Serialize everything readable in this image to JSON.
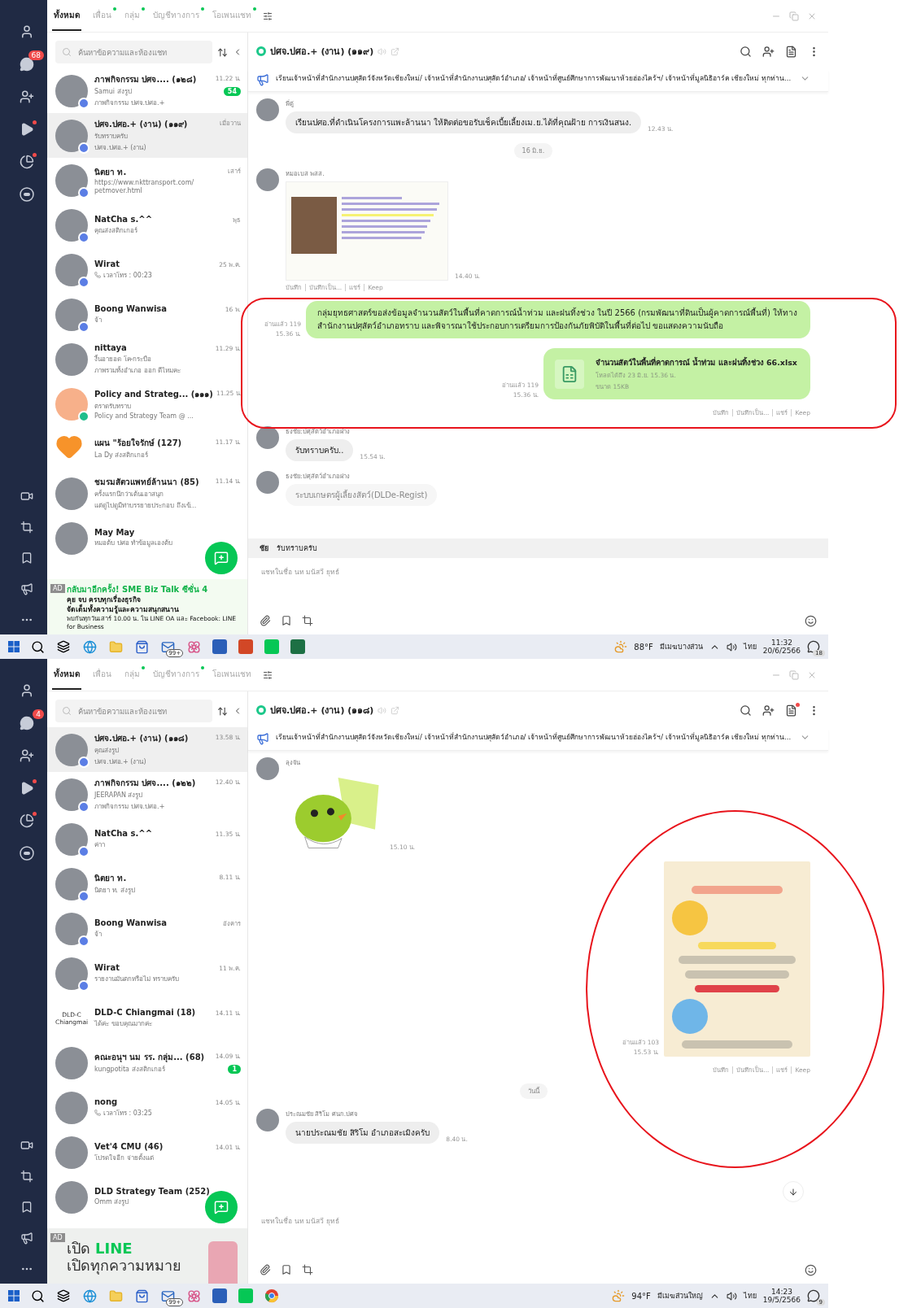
{
  "screens": [
    {
      "nav": {
        "chat_badge": "68"
      },
      "tabs": [
        {
          "label": "ทั้งหมด",
          "selected": true,
          "dot": false
        },
        {
          "label": "เพื่อน",
          "selected": false,
          "dot": true
        },
        {
          "label": "กลุ่ม",
          "selected": false,
          "dot": true
        },
        {
          "label": "บัญชีทางการ",
          "selected": false,
          "dot": true
        },
        {
          "label": "โอเพนแชท",
          "selected": false,
          "dot": true
        }
      ],
      "search": {
        "placeholder": "ค้นหาข้อความและห้องแชท"
      },
      "chats": [
        {
          "name": "ภาพกิจกรรม ปศจ.... (๑๒๘)",
          "time": "11.22 น.",
          "kind": "message",
          "avatar": {
            "kind": "photo"
          },
          "line1": "Samui ส่งรูป",
          "line2": "ภาพกิจกรรม ปศจ.ปศอ.+",
          "unread": "54",
          "selected": false
        },
        {
          "name": "ปศจ.ปศอ.+ (งาน) (๑๑๙)",
          "time": "เมื่อวาน",
          "kind": "message",
          "avatar": {
            "kind": "photo"
          },
          "line1": "รับทราบครับ",
          "line2": "ปศจ.ปศอ.+ (งาน)",
          "selected": true
        },
        {
          "name": "นิตยา ท.",
          "time": "เสาร์",
          "kind": "message",
          "avatar": {
            "kind": "photo"
          },
          "line1": "https://www.nkttransport.com/",
          "line2": "petmover.html",
          "selected": false
        },
        {
          "name": "NatCha s.^^",
          "time": "พุธ",
          "kind": "message",
          "avatar": {
            "kind": "photo"
          },
          "line1": "คุณส่งสติกเกอร์",
          "selected": false
        },
        {
          "name": "Wirat",
          "time": "25 พ.ค.",
          "kind": "call",
          "avatar": {
            "kind": "photo"
          },
          "line1": "เวลาโทร : 00:23",
          "selected": false
        },
        {
          "name": "Boong Wanwisa",
          "time": "16 พ.",
          "kind": "message",
          "avatar": {
            "kind": "photo"
          },
          "line1": "จ้า",
          "selected": false
        },
        {
          "name": "nittaya",
          "time": "11.29 น.",
          "kind": "message",
          "avatar": {
            "kind": "plain"
          },
          "line1": "งื้นอายอด โค-กระบือ",
          "line2": "ภาพรวมทั้งอำเภอ ออก ดีไหมคะ",
          "selected": false
        },
        {
          "name": "Policy and Strateg... (๑๑๑)",
          "time": "11.25 น.",
          "kind": "message",
          "avatar": {
            "kind": "group"
          },
          "line1": "ตราดรับทราบ",
          "line2": "Policy and Strategy Team @ ...",
          "selected": false
        },
        {
          "name": "แผน \"ร้อยใจรักษ์ (127)",
          "time": "11.17 น.",
          "kind": "message",
          "avatar": {
            "kind": "heart"
          },
          "line1": "La Dy ส่งสติกเกอร์",
          "selected": false
        },
        {
          "name": "ชมรมสัตวแพทย์ล้านนา (85)",
          "time": "11.14 น.",
          "kind": "message",
          "avatar": {
            "kind": "plain"
          },
          "line1": "ครั้งแรกนึกว่าเต้นเอาสนุก",
          "line2": "แต่ดูไปดูมีท่าบรรยายประกอบ ถึงเข้...",
          "selected": false
        },
        {
          "name": "May May",
          "kind": "message",
          "avatar": {
            "kind": "plain"
          },
          "line1": "หมอต้บ ปศอ ทำข้อมูลเองต้บ",
          "selected": false
        }
      ],
      "ad": {
        "kind": "biz",
        "tag": "AD",
        "lines": [
          "กลับมาอีกครั้ง! SME Biz Talk ซีซั่น 4",
          "คุย จบ ครบทุกเรื่องธุรกิจ",
          "จัดเต็มทั้งความรู้และความสนุกสนาน",
          "พบกันทุกวันเสาร์ 10.00 น. ใน LINE OA และ Facebook: LINE for Business"
        ]
      },
      "chat": {
        "title": "ปศจ.ปศอ.+ (งาน) (๑๑๙)",
        "notes_dot": false,
        "announcement": "เรียนเจ้าหน้าที่สำนักงานปศุสัตว์จังหวัดเชียงใหม่/ เจ้าหน้าที่สำนักงานปศุสัตว์อำเภอ/ เจ้าหน้าที่ศูนย์ศึกษาการพัฒนาห้วยฮ่องไคร้ฯ/ เจ้าหน้าที่มูลนิธิอาร์ค เชียงใหม่ ทุกท่าน...",
        "messages": [
          {
            "kind": "text_in",
            "sender": "พี่ตู่",
            "text": "เรียนปศอ.ที่ดำเนินโครงการแพะล้านนา ให้ติดต่อขอรับเช็คเบี้ยเลี้ยงเม.ย.ได้ที่คุณฝ้าย การเงินสนง.",
            "time": "12.43 น."
          },
          {
            "kind": "date",
            "text": "16 มิ.ย."
          },
          {
            "kind": "image_in",
            "sender": "หมอเบส พสส.",
            "time": "14.40 น.",
            "actions": [
              "บันทึก",
              "บันทึกเป็น...",
              "แชร์",
              "Keep"
            ]
          },
          {
            "kind": "text_out",
            "read": "อ่านแล้ว 119",
            "time": "15.36 น.",
            "text": "กลุ่มยุทธศาสตร์ขอส่งข้อมูลจำนวนสัตว์ในพื้นที่คาดการณ์น้ำท่วม และฝนทิ้งช่วง ในปี 2566 (กรมพัฒนาที่ดินเป็นผู้คาดการณ์พื้นที่) ให้ทางสำนักงานปศุสัตว์อำเภอทราบ และพิจารณาใช้ประกอบการเตรียมการป้องกันภัยพิบัติในพื้นที่ต่อไป  ขอแสดงความนับถือ"
          },
          {
            "kind": "file_out",
            "read": "อ่านแล้ว 119",
            "time": "15.36 น.",
            "filename": "จำนวนสัตว์ในพื้นที่คาดการณ์ น้ำท่วม และฝนทิ้งช่วง 66.xlsx",
            "expiry": "โหลดได้ถึง 23 มิ.ย. 15.36 น.",
            "size": "ขนาด 15KB",
            "actions": [
              "บันทึก",
              "บันทึกเป็น...",
              "แชร์",
              "Keep"
            ]
          },
          {
            "kind": "text_in",
            "sender": "ธงชัย:ปศุสัตว์อำเภอฝาง",
            "text": "รับทราบครับ..",
            "time": "15.54 น."
          },
          {
            "kind": "faded_in",
            "sender": "ธงชัย:ปศุสัตว์อำเภอฝาง",
            "text": "ระบบเกษตรผู้เลี้ยงสัตว์(DLDe-Regist)"
          }
        ],
        "reply": {
          "name": "ชัย",
          "text": "รับทราบครับ"
        },
        "input": {
          "placeholder": "แชทในชื่อ นท มนัสวี ยุทธ์"
        },
        "scroll_down": false
      },
      "annotation": {
        "kind": "rect"
      },
      "taskbar": {
        "apps": [
          {
            "kind": "search"
          },
          {
            "kind": "taskview"
          },
          {
            "kind": "edge"
          },
          {
            "kind": "folder"
          },
          {
            "kind": "store"
          },
          {
            "kind": "mail",
            "badge": "99+"
          },
          {
            "kind": "flower"
          },
          {
            "kind": "word"
          },
          {
            "kind": "powerpoint"
          },
          {
            "kind": "line"
          },
          {
            "kind": "excel"
          }
        ],
        "temp": "88°F",
        "weather": "มีเมฆบางส่วน",
        "lang": "ไทย",
        "time": "11:32",
        "date": "20/6/2566",
        "notifications": "18"
      }
    },
    {
      "nav": {
        "chat_badge": "4"
      },
      "tabs": [
        {
          "label": "ทั้งหมด",
          "selected": true,
          "dot": false
        },
        {
          "label": "เพื่อน",
          "selected": false,
          "dot": false
        },
        {
          "label": "กลุ่ม",
          "selected": false,
          "dot": true
        },
        {
          "label": "บัญชีทางการ",
          "selected": false,
          "dot": true
        },
        {
          "label": "โอเพนแชท",
          "selected": false,
          "dot": false
        }
      ],
      "search": {
        "placeholder": "ค้นหาข้อความและห้องแชท"
      },
      "chats": [
        {
          "name": "ปศจ.ปศอ.+ (งาน) (๑๑๘)",
          "time": "13.58 น.",
          "kind": "message",
          "avatar": {
            "kind": "photo"
          },
          "line1": "คุณส่งรูป",
          "line2": "ปศจ.ปศอ.+ (งาน)",
          "selected": true
        },
        {
          "name": "ภาพกิจกรรม ปศจ.... (๑๒๒)",
          "time": "12.40 น.",
          "kind": "message",
          "avatar": {
            "kind": "photo"
          },
          "line1": "JEERAPAN ส่งรูป",
          "line2": "ภาพกิจกรรม ปศจ.ปศอ.+",
          "selected": false
        },
        {
          "name": "NatCha s.^^",
          "time": "11.35 น.",
          "kind": "message",
          "avatar": {
            "kind": "photo"
          },
          "line1": "ค่าา",
          "selected": false
        },
        {
          "name": "นิตยา ท.",
          "time": "8.11 น.",
          "kind": "message",
          "avatar": {
            "kind": "photo"
          },
          "line1": "นิตยา ท. ส่งรูป",
          "selected": false
        },
        {
          "name": "Boong Wanwisa",
          "time": "อังคาร",
          "kind": "message",
          "avatar": {
            "kind": "photo"
          },
          "line1": "จ้า",
          "selected": false
        },
        {
          "name": "Wirat",
          "time": "11 พ.ค.",
          "kind": "message",
          "avatar": {
            "kind": "photo"
          },
          "line1": "รายงานมันตกหรือไม่ ทราบครับ",
          "selected": false
        },
        {
          "name": "DLD-C Chiangmai (18)",
          "time": "14.11 น.",
          "kind": "message",
          "avatar": {
            "kind": "text",
            "text": "DLD-C Chiangmai"
          },
          "line1": "ได้ค่ะ ขอบคุณมากค่ะ",
          "selected": false
        },
        {
          "name": "คณะอนุฯ นม รร. กลุ่ม... (68)",
          "time": "14.09 น.",
          "kind": "message",
          "avatar": {
            "kind": "plain"
          },
          "line1": "kungpotita ส่งสติกเกอร์",
          "unread": "1",
          "selected": false
        },
        {
          "name": "nong",
          "time": "14.05 น.",
          "kind": "call",
          "avatar": {
            "kind": "plain"
          },
          "line1": "เวลาโทร : 03:25",
          "selected": false
        },
        {
          "name": "Vet'4 CMU (46)",
          "time": "14.01 น.",
          "kind": "message",
          "avatar": {
            "kind": "plain"
          },
          "line1": "โปรดใจอีก จ่ายตั้งแต่",
          "selected": false
        },
        {
          "name": "DLD Strategy Team (252)",
          "kind": "message",
          "avatar": {
            "kind": "plain"
          },
          "line1": "Omm ส่งรูป",
          "selected": false
        }
      ],
      "ad": {
        "kind": "brand",
        "tag": "AD",
        "lines": [
          "เปิด",
          "LINE",
          "เปิดทุกความหมาย"
        ]
      },
      "chat": {
        "title": "ปศจ.ปศอ.+ (งาน) (๑๑๘)",
        "notes_dot": true,
        "announcement": "เรียนเจ้าหน้าที่สำนักงานปศุสัตว์จังหวัดเชียงใหม่/ เจ้าหน้าที่สำนักงานปศุสัตว์อำเภอ/ เจ้าหน้าที่ศูนย์ศึกษาการพัฒนาห้วยฮ่องไคร้ฯ/ เจ้าหน้าที่มูลนิธิอาร์ค เชียงใหม่ ทุกท่าน...",
        "messages": [
          {
            "kind": "sticker_in",
            "sender": "ลุงจัน",
            "time": "15.10 น."
          },
          {
            "kind": "image_out",
            "read": "อ่านแล้ว 103",
            "time": "15.53 น.",
            "actions": [
              "บันทึก",
              "บันทึกเป็น...",
              "แชร์",
              "Keep"
            ]
          },
          {
            "kind": "date",
            "text": "วันนี้"
          },
          {
            "kind": "text_in",
            "sender": "ประณมชัย สิริโม ศนก.ปศจ",
            "text": "นายประณมชัย สิริโม อำเภอสะเมิงครับ",
            "time": "8.40 น."
          }
        ],
        "input": {
          "placeholder": "แชทในชื่อ นท มนัสวี ยุทธ์"
        },
        "scroll_down": true
      },
      "annotation": {
        "kind": "ellipse"
      },
      "taskbar": {
        "apps": [
          {
            "kind": "search"
          },
          {
            "kind": "taskview"
          },
          {
            "kind": "edge"
          },
          {
            "kind": "folder"
          },
          {
            "kind": "store"
          },
          {
            "kind": "mail",
            "badge": "99+"
          },
          {
            "kind": "flower"
          },
          {
            "kind": "word"
          },
          {
            "kind": "line"
          },
          {
            "kind": "chrome"
          }
        ],
        "temp": "94°F",
        "weather": "มีเมฆส่วนใหญ่",
        "lang": "ไทย",
        "time": "14:23",
        "date": "19/5/2566",
        "notifications": "9"
      }
    }
  ]
}
